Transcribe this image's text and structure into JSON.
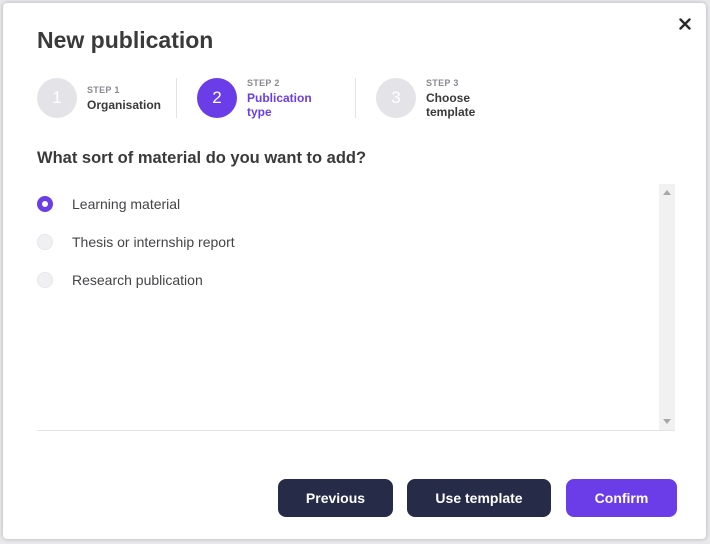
{
  "dialog": {
    "title": "New publication",
    "close_icon": "close-icon"
  },
  "steps": [
    {
      "number": "1",
      "kicker": "STEP 1",
      "label": "Organisation",
      "active": false
    },
    {
      "number": "2",
      "kicker": "STEP 2",
      "label": "Publication type",
      "active": true
    },
    {
      "number": "3",
      "kicker": "STEP 3",
      "label": "Choose template",
      "active": false
    }
  ],
  "question": "What sort of material do you want to add?",
  "options": [
    {
      "label": "Learning material",
      "selected": true
    },
    {
      "label": "Thesis or internship report",
      "selected": false
    },
    {
      "label": "Research publication",
      "selected": false
    }
  ],
  "buttons": {
    "previous": "Previous",
    "use_template": "Use template",
    "confirm": "Confirm"
  },
  "colors": {
    "accent": "#6a3de8",
    "dark_button": "#262b47",
    "inactive_step": "#e4e4e8",
    "text": "#3a3a3a"
  }
}
